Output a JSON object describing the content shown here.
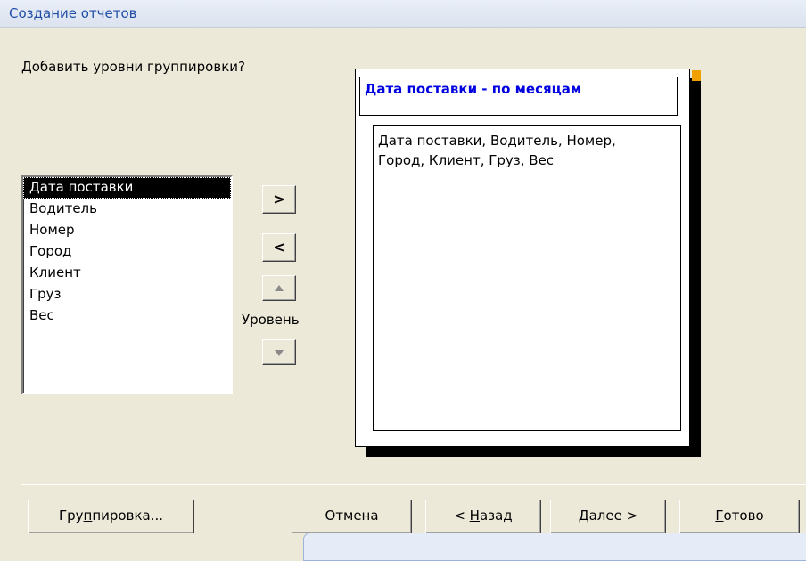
{
  "window": {
    "title": "Создание отчетов"
  },
  "question": "Добавить уровни группировки?",
  "fields": [
    "Дата поставки",
    "Водитель",
    "Номер",
    "Город",
    "Клиент",
    "Груз",
    "Вес"
  ],
  "selected_field_index": 0,
  "level_label": "Уровень",
  "side_buttons": {
    "add": ">",
    "remove": "<"
  },
  "preview": {
    "group_header": "Дата поставки - по месяцам",
    "detail_line1": "Дата поставки, Водитель, Номер,",
    "detail_line2": "Город, Клиент, Груз, Вес"
  },
  "buttons": {
    "grouping_pre": "Гру",
    "grouping_key": "п",
    "grouping_post": "пировка...",
    "cancel": "Отмена",
    "back_pre": "< ",
    "back_key": "Н",
    "back_post": "азад",
    "next_key": "Д",
    "next_post": "алее >",
    "finish_key": "Г",
    "finish_post": "отово"
  }
}
